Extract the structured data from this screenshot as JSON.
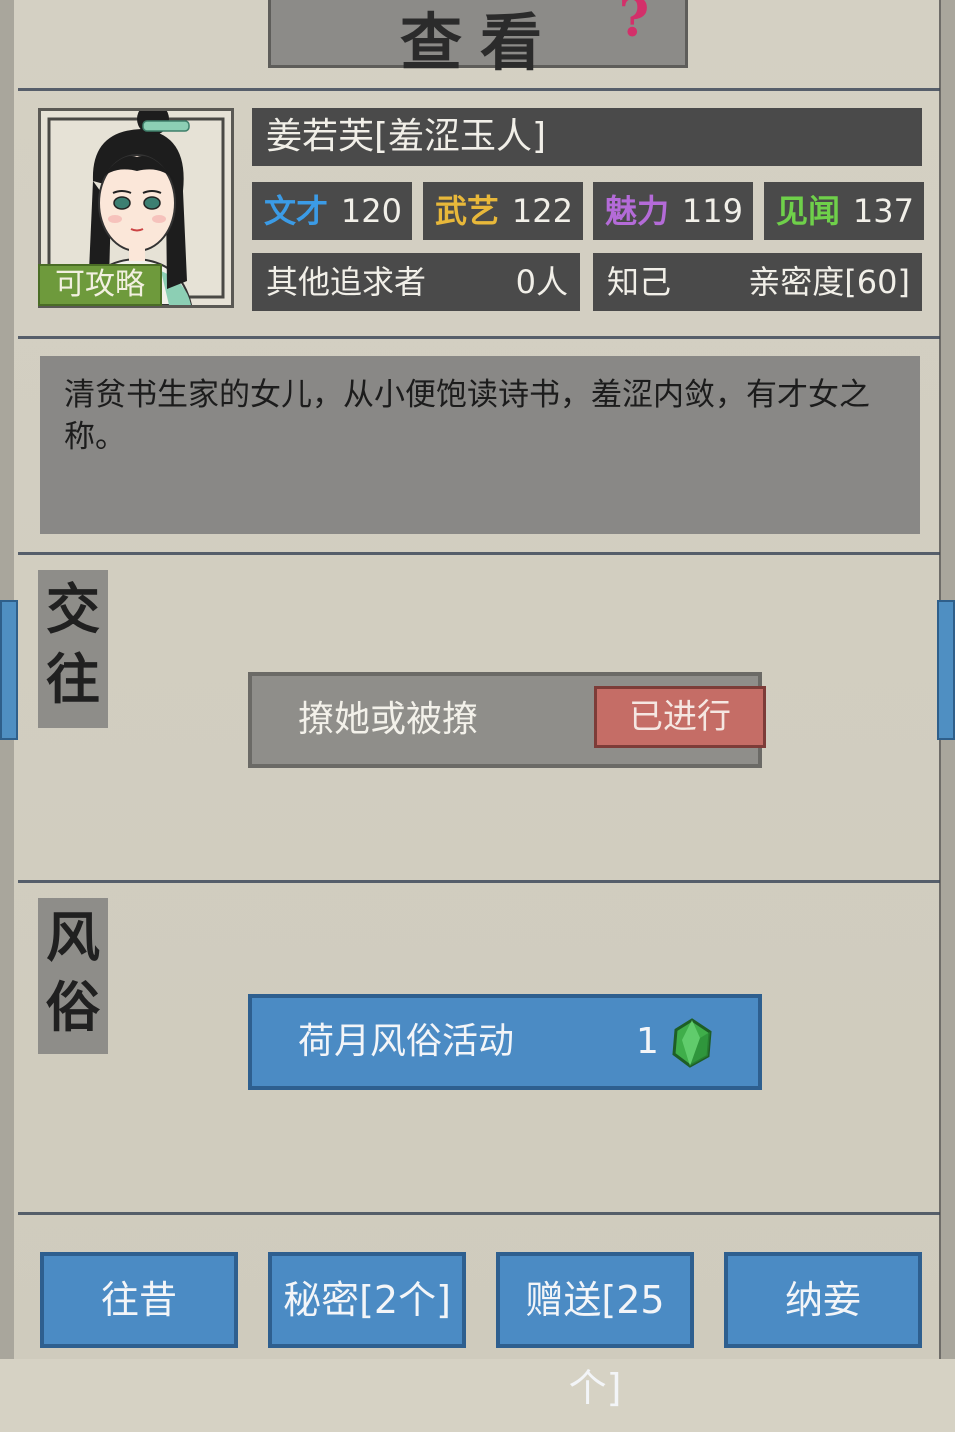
{
  "header": {
    "title": "查看",
    "help_icon": "question-icon"
  },
  "character": {
    "name": "姜若芙[羞涩玉人]",
    "tag": "可攻略",
    "stats": [
      {
        "label": "文才",
        "value": "120",
        "color": "#3b9be6"
      },
      {
        "label": "武艺",
        "value": "122",
        "color": "#e8b83a"
      },
      {
        "label": "魅力",
        "value": "119",
        "color": "#b46bd8"
      },
      {
        "label": "见闻",
        "value": "137",
        "color": "#6fd04a"
      }
    ],
    "suitors_label": "其他追求者",
    "suitors_value": "0人",
    "relation_label": "知己",
    "intimacy": "亲密度[60]",
    "description": "清贫书生家的女儿，从小便饱读诗书，羞涩内敛，有才女之称。"
  },
  "sections": {
    "interaction": {
      "label": "交往",
      "action_label": "撩她或被撩",
      "action_status": "已进行"
    },
    "custom": {
      "label": "风俗",
      "action_label": "荷月风俗活动",
      "cost": "1",
      "cost_icon": "green-gem-icon"
    }
  },
  "bottom_buttons": [
    {
      "label": "往昔"
    },
    {
      "label": "秘密[2个]"
    },
    {
      "label": "赠送[25个]"
    },
    {
      "label": "纳妾"
    }
  ]
}
